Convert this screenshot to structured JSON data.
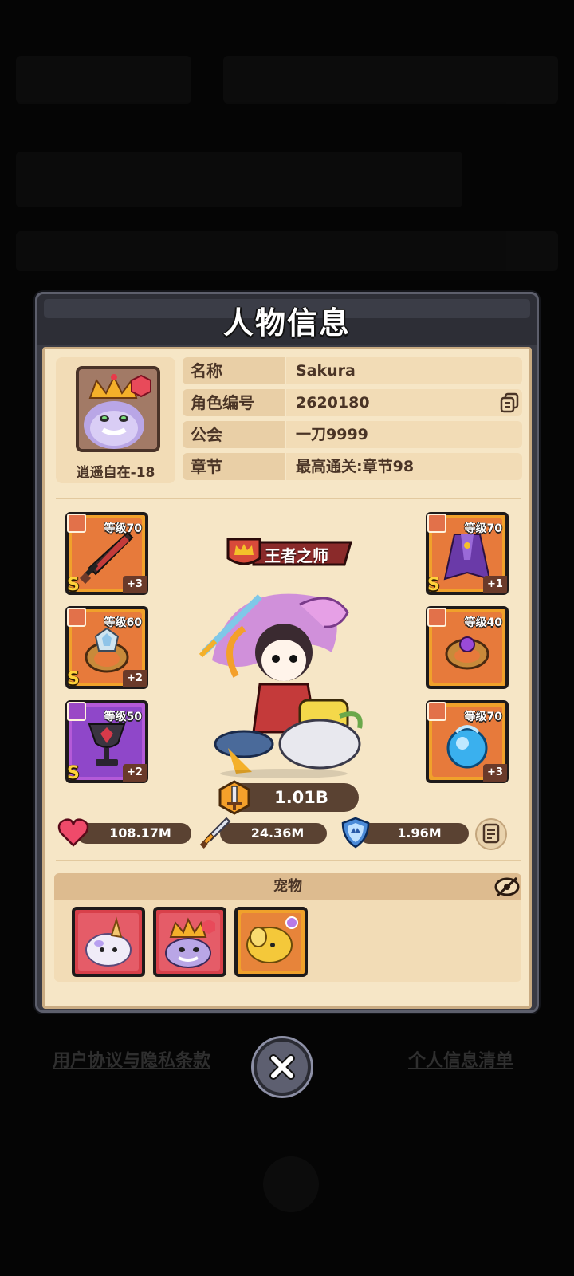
{
  "dialog": {
    "title": "人物信息"
  },
  "player": {
    "avatar_name": "逍遥自在-18",
    "rows": [
      {
        "key": "名称",
        "value": "Sakura"
      },
      {
        "key": "角色编号",
        "value": "2620180"
      },
      {
        "key": "公会",
        "value": "一刀9999"
      },
      {
        "key": "章节",
        "value": "最高通关:章节98"
      }
    ]
  },
  "equipment": {
    "left": [
      {
        "slot": "weapon",
        "level": "等级70",
        "rank": "S",
        "plus": "+3",
        "rarity": "orange",
        "icon": "sword-icon"
      },
      {
        "slot": "ring",
        "level": "等级60",
        "rank": "S",
        "plus": "+2",
        "rarity": "orange",
        "icon": "ring-icon"
      },
      {
        "slot": "amulet",
        "level": "等级50",
        "rank": "S",
        "plus": "+2",
        "rarity": "purple",
        "icon": "chalice-icon"
      }
    ],
    "right": [
      {
        "slot": "armor",
        "level": "等级70",
        "rank": "S",
        "plus": "+1",
        "rarity": "orange",
        "icon": "cloak-icon"
      },
      {
        "slot": "ring",
        "level": "等级40",
        "rank": "",
        "plus": "",
        "rarity": "orange",
        "icon": "gem-ring-icon"
      },
      {
        "slot": "necklace",
        "level": "等级70",
        "rank": "",
        "plus": "+3",
        "rarity": "orange",
        "icon": "orb-icon"
      }
    ]
  },
  "hero": {
    "title_badge": "王者之师",
    "power": "1.01B"
  },
  "stats": {
    "hp": "108.17M",
    "attack": "24.36M",
    "defense": "1.96M"
  },
  "pets": {
    "header": "宠物",
    "items": [
      {
        "name": "unicorn-slime",
        "rarity": "red"
      },
      {
        "name": "king-slime",
        "rarity": "red"
      },
      {
        "name": "golden-creature",
        "rarity": "orange"
      }
    ]
  },
  "footer": {
    "left_link": "用户协议与隐私条款",
    "right_link": "个人信息清单"
  },
  "colors": {
    "panel_bg": "#f6e6c6",
    "dialog_frame": "#3a3b44",
    "orange_rarity": "#f0a12b",
    "purple_rarity": "#b45ad8",
    "red_rarity": "#d8404a"
  }
}
